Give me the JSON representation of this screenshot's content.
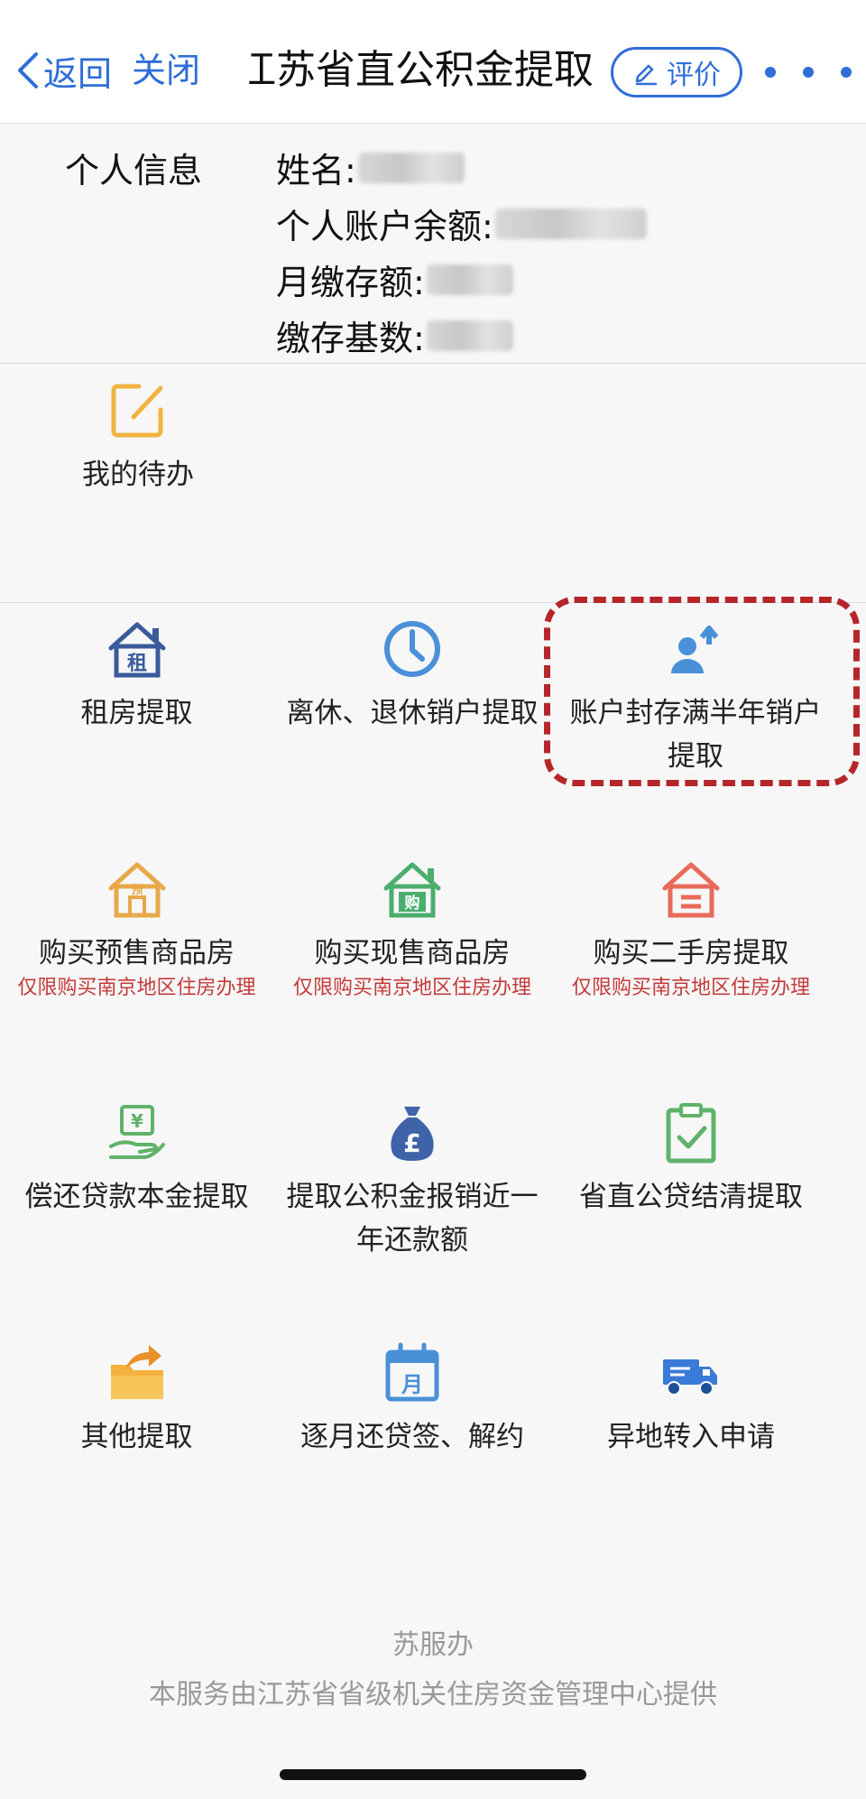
{
  "nav": {
    "back_label": "返回",
    "close_label": "关闭",
    "title": "江苏省直公积金提取",
    "rate_label": "评价"
  },
  "personal_info": {
    "section_title": "个人信息",
    "name_label": "姓名:",
    "balance_label": "个人账户余额:",
    "monthly_label": "月缴存额:",
    "base_label": "缴存基数:"
  },
  "todo": {
    "label": "我的待办",
    "icon": "edit-square-icon"
  },
  "items": [
    {
      "label": "租房提取",
      "icon": "rent-house-icon"
    },
    {
      "label": "离休、退休销户提取",
      "icon": "clock-icon"
    },
    {
      "label": "账户封存满半年销户提取",
      "icon": "user-upload-icon"
    },
    {
      "label": "购买预售商品房",
      "note": "仅限购买南京地区住房办理",
      "icon": "presale-house-icon"
    },
    {
      "label": "购买现售商品房",
      "note": "仅限购买南京地区住房办理",
      "icon": "buy-house-icon"
    },
    {
      "label": "购买二手房提取",
      "note": "仅限购买南京地区住房办理",
      "icon": "second-hand-house-icon"
    },
    {
      "label": "偿还贷款本金提取",
      "icon": "repay-yuan-icon"
    },
    {
      "label": "提取公积金报销近一年还款额",
      "icon": "money-bag-icon"
    },
    {
      "label": "省直公贷结清提取",
      "icon": "clipboard-check-icon"
    },
    {
      "label": "其他提取",
      "icon": "folder-arrow-icon"
    },
    {
      "label": "逐月还贷签、解约",
      "icon": "calendar-month-icon"
    },
    {
      "label": "异地转入申请",
      "icon": "truck-icon"
    }
  ],
  "footer": {
    "brand": "苏服办",
    "note": "本服务由江苏省省级机关住房资金管理中心提供"
  },
  "colors": {
    "accent": "#2f6ed8",
    "highlight": "#b5262a",
    "note_red": "#c43a3a"
  }
}
